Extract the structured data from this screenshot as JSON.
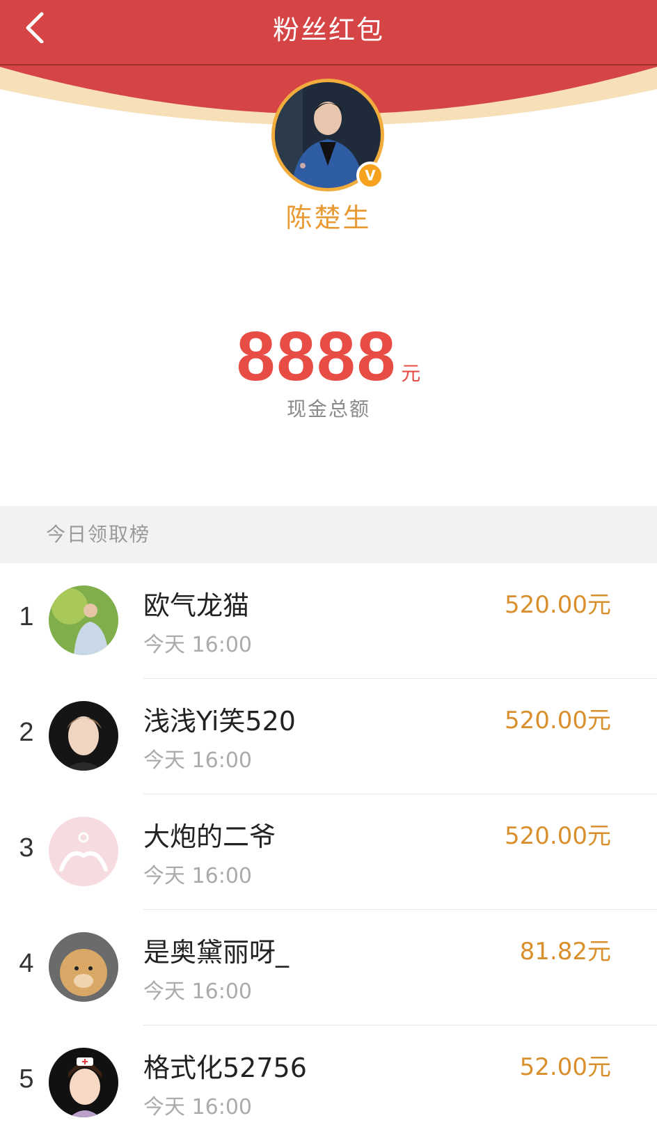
{
  "header": {
    "title": "粉丝红包",
    "back_icon": "chevron-left-icon",
    "colors": {
      "primary": "#d64546",
      "rim": "#f7dfb8"
    }
  },
  "profile": {
    "name": "陈楚生",
    "verified_badge": "V"
  },
  "summary": {
    "amount": "8888",
    "unit": "元",
    "label": "现金总额"
  },
  "leaderboard": {
    "title": "今日领取榜",
    "rows": [
      {
        "rank": "1",
        "name": "欧气龙猫",
        "time": "今天 16:00",
        "amount": "520.00元"
      },
      {
        "rank": "2",
        "name": "浅浅Yi笑520",
        "time": "今天 16:00",
        "amount": "520.00元"
      },
      {
        "rank": "3",
        "name": "大炮的二爷",
        "time": "今天 16:00",
        "amount": "520.00元"
      },
      {
        "rank": "4",
        "name": "是奥黛丽呀_",
        "time": "今天 16:00",
        "amount": "81.82元"
      },
      {
        "rank": "5",
        "name": "格式化52756",
        "time": "今天 16:00",
        "amount": "52.00元"
      }
    ]
  }
}
